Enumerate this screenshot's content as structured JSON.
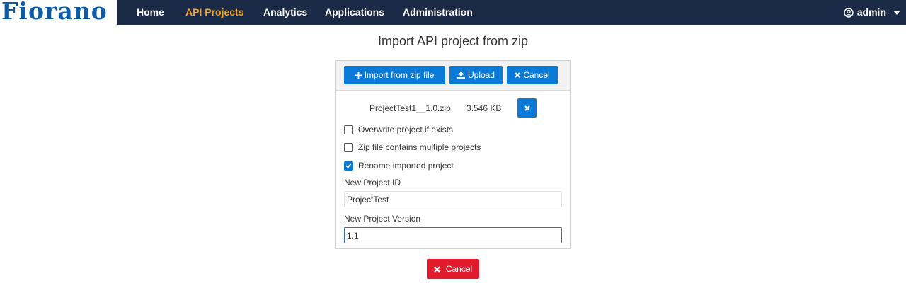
{
  "brand": {
    "logo_text": "Fiorano"
  },
  "nav": {
    "items": [
      {
        "label": "Home"
      },
      {
        "label": "API Projects",
        "active": true
      },
      {
        "label": "Analytics"
      },
      {
        "label": "Applications"
      },
      {
        "label": "Administration"
      }
    ],
    "user": {
      "label": "admin",
      "icon": "user-circle-icon"
    }
  },
  "page": {
    "title": "Import API project from zip"
  },
  "toolbar": {
    "import_label": "Import from zip file",
    "upload_label": "Upload",
    "cancel_label": "Cancel"
  },
  "file": {
    "name": "ProjectTest1__1.0.zip",
    "size": "3.546 KB"
  },
  "options": {
    "overwrite": {
      "label": "Overwrite project if exists",
      "checked": false
    },
    "multiple": {
      "label": "Zip file contains multiple projects",
      "checked": false
    },
    "rename": {
      "label": "Rename imported project",
      "checked": true
    }
  },
  "form": {
    "project_id_label": "New Project ID",
    "project_id_value": "ProjectTest",
    "project_version_label": "New Project Version",
    "project_version_value": "1.1"
  },
  "footer": {
    "cancel_label": "Cancel"
  },
  "colors": {
    "navbar": "#1b2a47",
    "active_nav": "#f5a623",
    "primary": "#0b7ad6",
    "danger": "#e21b2c",
    "logo": "#0d5ca8"
  }
}
